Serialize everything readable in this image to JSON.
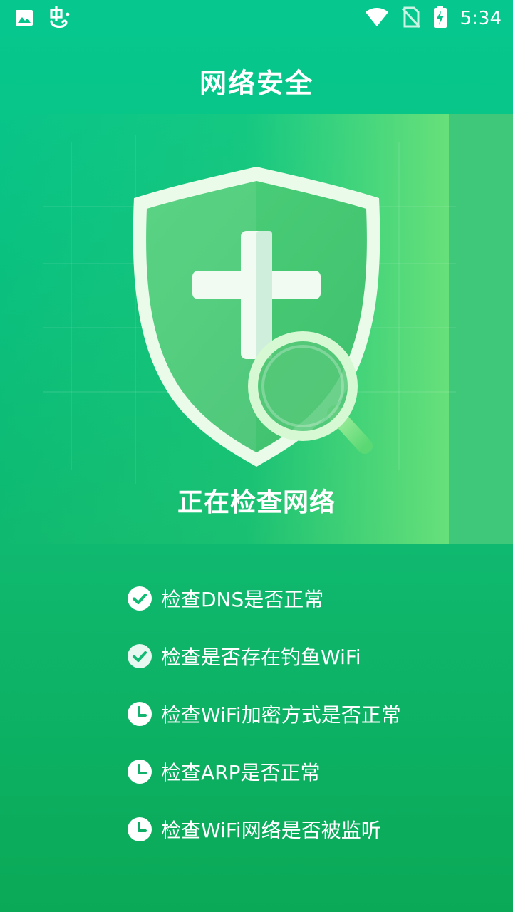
{
  "status_bar": {
    "time": "5:34",
    "left_icons": [
      "image-icon",
      "bug-icon"
    ],
    "right_icons": [
      "wifi-icon",
      "no-sim-icon",
      "battery-charging-icon"
    ]
  },
  "header": {
    "title": "网络安全"
  },
  "hero": {
    "illustration": "shield-plus-magnifier-icon",
    "status_text": "正在检查网络"
  },
  "checks": [
    {
      "label": "检查DNS是否正常",
      "state": "done",
      "icon": "check-circle-icon"
    },
    {
      "label": "检查是否存在钓鱼WiFi",
      "state": "done",
      "icon": "check-circle-icon"
    },
    {
      "label": "检查WiFi加密方式是否正常",
      "state": "pending",
      "icon": "clock-icon"
    },
    {
      "label": "检查ARP是否正常",
      "state": "pending",
      "icon": "clock-icon"
    },
    {
      "label": "检查WiFi网络是否被监听",
      "state": "pending",
      "icon": "clock-icon"
    }
  ],
  "colors": {
    "background_top": "#06c88f",
    "background_bottom": "#0aa957",
    "hero_highlight": "#67e07a",
    "text": "#ffffff",
    "done_check": "#ffffff",
    "pending_clock": "#ffffff"
  }
}
